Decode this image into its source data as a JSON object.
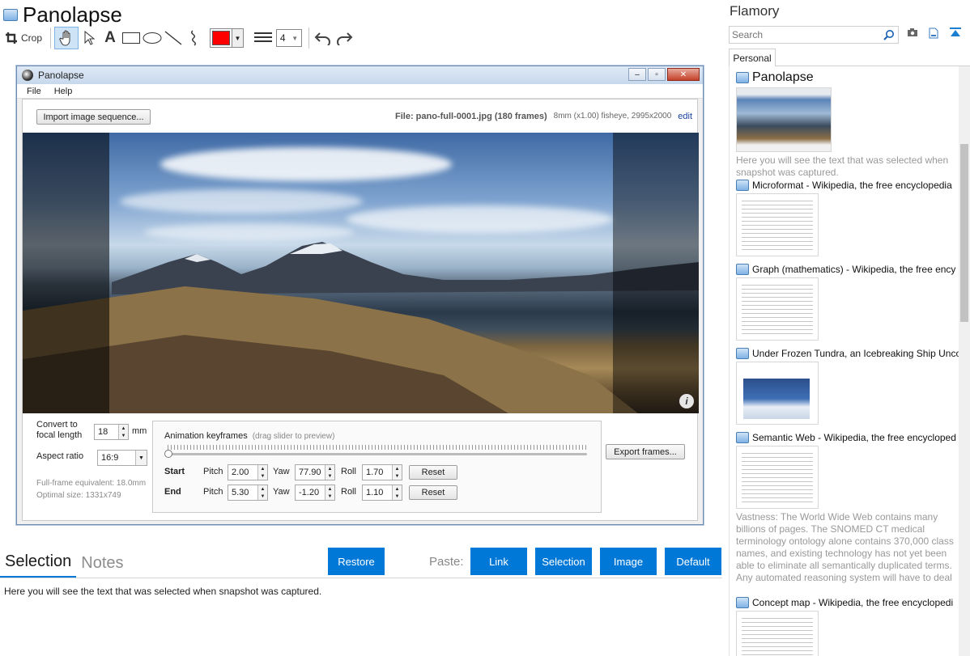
{
  "app": {
    "title": "Panolapse"
  },
  "toolbar": {
    "crop_label": "Crop",
    "line_width": "4",
    "color": "#ff0000"
  },
  "shot": {
    "window_title": "Panolapse",
    "menu": [
      "File",
      "Help"
    ],
    "import_button": "Import image sequence...",
    "file_name": "File: pano-full-0001.jpg (180 frames)",
    "file_meta": "8mm (x1.00) fisheye, 2995x2000",
    "edit_link": "edit",
    "focal_label_1": "Convert to",
    "focal_label_2": "focal length",
    "focal_value": "18",
    "focal_unit": "mm",
    "aspect_label": "Aspect ratio",
    "aspect_value": "16:9",
    "full_frame": "Full-frame equivalent: 18.0mm",
    "optimal": "Optimal size: 1331x749",
    "kf_title": "Animation keyframes",
    "kf_hint": "(drag slider to preview)",
    "start_label": "Start",
    "end_label": "End",
    "pitch_label": "Pitch",
    "yaw_label": "Yaw",
    "roll_label": "Roll",
    "start": {
      "pitch": "2.00",
      "yaw": "77.90",
      "roll": "1.70"
    },
    "end": {
      "pitch": "5.30",
      "yaw": "-1.20",
      "roll": "1.10"
    },
    "reset_label": "Reset",
    "export_button": "Export frames..."
  },
  "bottom": {
    "tabs": [
      "Selection",
      "Notes"
    ],
    "restore": "Restore",
    "paste_label": "Paste:",
    "paste_buttons": [
      "Link",
      "Selection",
      "Image",
      "Default"
    ],
    "notes_text": "Here you will see the text that was selected when snapshot was captured."
  },
  "sidebar": {
    "title": "Flamory",
    "search_placeholder": "Search",
    "tab": "Personal",
    "items": [
      {
        "title": "Panolapse",
        "desc": "Here you will see the text that was selected when snapshot was captured."
      },
      {
        "title": "Microformat - Wikipedia, the free encyclopedia",
        "desc": ""
      },
      {
        "title": "Graph (mathematics) - Wikipedia, the free ency",
        "desc": ""
      },
      {
        "title": "Under Frozen Tundra, an Icebreaking Ship Unco",
        "desc": ""
      },
      {
        "title": "Semantic Web - Wikipedia, the free encycloped",
        "desc": "Vastness: The World Wide Web contains many billions of pages. The SNOMED CT medical terminology ontology alone contains 370,000 class names, and existing technology has not yet been able to eliminate all semantically duplicated terms. Any automated reasoning system will have to deal with truly huge inputs."
      },
      {
        "title": "Concept map - Wikipedia, the free encyclopedi",
        "desc": ""
      }
    ]
  },
  "colors": {
    "accent": "#0078d7"
  }
}
